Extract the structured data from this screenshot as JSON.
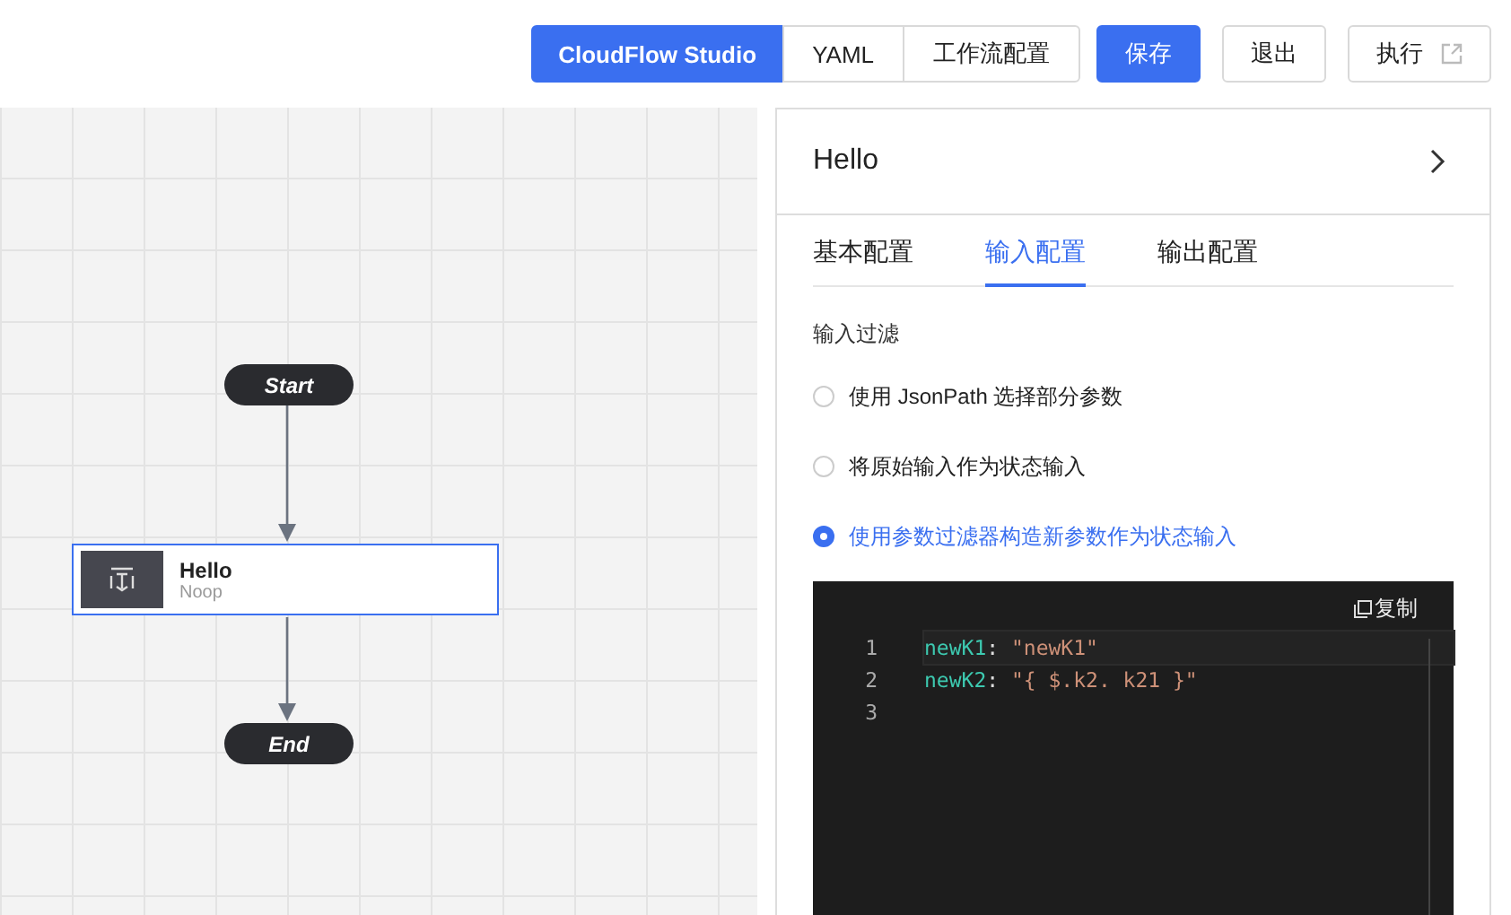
{
  "toolbar": {
    "view_tabs": [
      {
        "label": "CloudFlow Studio",
        "selected": true
      },
      {
        "label": "YAML",
        "selected": false
      },
      {
        "label": "工作流配置",
        "selected": false
      }
    ],
    "buttons": [
      {
        "label": "保存",
        "kind": "primary"
      },
      {
        "label": "退出",
        "kind": "plain"
      },
      {
        "label": "执行",
        "kind": "external"
      }
    ]
  },
  "diagram": {
    "nodes": [
      {
        "kind": "terminal",
        "label": "Start"
      },
      {
        "kind": "state",
        "label": "Hello",
        "type": "Noop",
        "selected": true
      },
      {
        "kind": "terminal",
        "label": "End"
      }
    ]
  },
  "panel": {
    "title": "Hello",
    "tabs": [
      {
        "label": "基本配置",
        "selected": false
      },
      {
        "label": "输入配置",
        "selected": true
      },
      {
        "label": "输出配置",
        "selected": false
      }
    ],
    "section_label": "输入过滤",
    "options": [
      {
        "label": "使用 JsonPath 选择部分参数",
        "selected": false
      },
      {
        "label": "将原始输入作为状态输入",
        "selected": false
      },
      {
        "label": "使用参数过滤器构造新参数作为状态输入",
        "selected": true
      }
    ],
    "editor": {
      "copy_label": "复制",
      "lines": [
        {
          "number": "1",
          "key": "newK1",
          "punct": ":",
          "value": "\"newK1\"",
          "current": true
        },
        {
          "number": "2",
          "key": "newK2",
          "punct": ":",
          "value": "\"{ $.k2. k21 }\"",
          "current": false
        },
        {
          "number": "3"
        }
      ]
    }
  }
}
